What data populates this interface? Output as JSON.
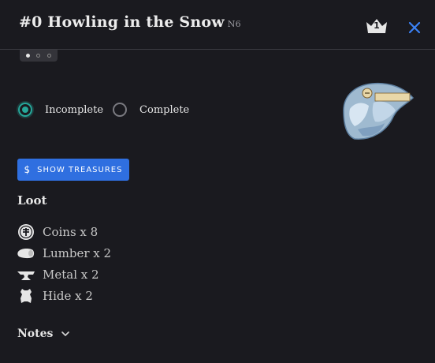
{
  "header": {
    "title": "#0 Howling in the Snow",
    "code": "N6",
    "crown_level": "1",
    "close_icon": "close-icon"
  },
  "pager": {
    "count": 3,
    "active": 0
  },
  "status": {
    "options": [
      "Incomplete",
      "Complete"
    ],
    "selected": "Incomplete",
    "accent": "#26a79a"
  },
  "treasure_button": {
    "icon": "$",
    "label": "SHOW TREASURES",
    "color": "#2f6fe0"
  },
  "loot": {
    "heading": "Loot",
    "items": [
      {
        "icon": "coin-icon",
        "text": "Coins x 8"
      },
      {
        "icon": "lumber-icon",
        "text": "Lumber x 2"
      },
      {
        "icon": "anvil-icon",
        "text": "Metal x 2"
      },
      {
        "icon": "hide-icon",
        "text": "Hide x 2"
      }
    ]
  },
  "notes": {
    "label": "Notes",
    "icon": "chevron-down-icon"
  }
}
